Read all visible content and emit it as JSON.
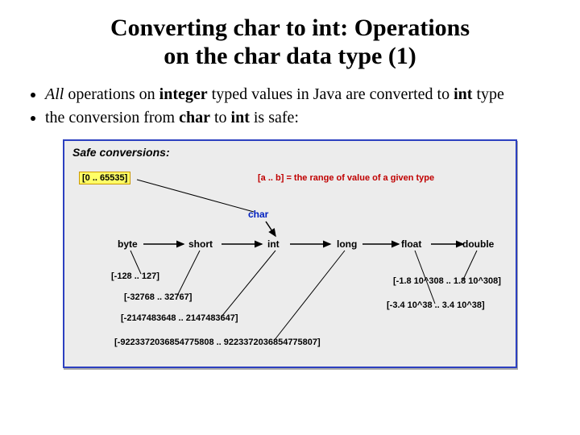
{
  "title_line1": "Converting char to int: Operations",
  "title_line2": "on the char data type (1)",
  "bullets": [
    {
      "pre": "",
      "em1": "All",
      "mid1": " operations on ",
      "bold1": "integer",
      "mid2": " typed values in Java are converted to ",
      "bold2": "int",
      "post": " type"
    },
    {
      "pre": "the conversion from ",
      "bold1": "char",
      "mid1": " to ",
      "bold2": "int",
      "post": " is safe:"
    }
  ],
  "diagram": {
    "heading": "Safe conversions:",
    "range_def": "[a .. b] = the range of value of a given type",
    "types": {
      "char": "char",
      "byte": "byte",
      "short": "short",
      "int": "int",
      "long": "long",
      "float": "float",
      "double": "double"
    },
    "ranges": {
      "char": "[0 .. 65535]",
      "byte": "[-128 .. 127]",
      "short": "[-32768 .. 32767]",
      "int": "[-2147483648 .. 2147483647]",
      "long": "[-9223372036854775808 .. 9223372036854775807]",
      "float": "[-3.4 10^38 .. 3.4 10^38]",
      "double": "[-1.8 10^308 .. 1.8 10^308]"
    }
  }
}
